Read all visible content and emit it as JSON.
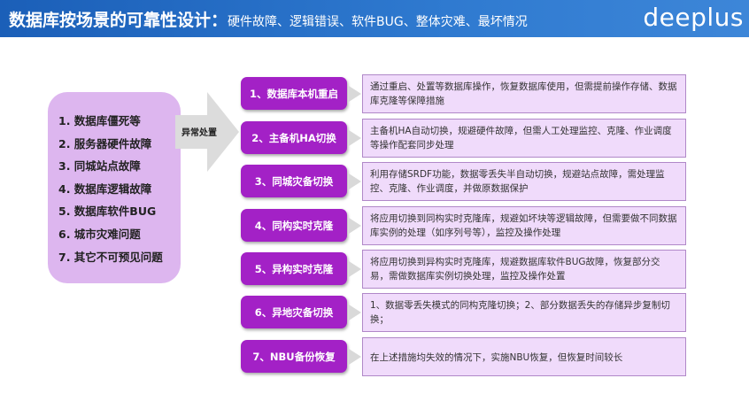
{
  "header": {
    "title_main": "数据库按场景的可靠性设计：",
    "title_sub": "硬件故障、逻辑错误、软件BUG、整体灾难、最坏情况",
    "logo": "deeplus"
  },
  "causes": [
    "1. 数据库僵死等",
    "2. 服务器硬件故障",
    "3. 同城站点故障",
    "4. 数据库逻辑故障",
    "5. 数据库软件BUG",
    "6. 城市灾难问题",
    "7. 其它不可预见问题"
  ],
  "arrow_label": "异常处置",
  "steps": [
    {
      "label": "1、数据库本机重启",
      "desc": "通过重启、处置等数据库操作，恢复数据库使用，但需提前操作存储、数据库克隆等保障措施"
    },
    {
      "label": "2、主备机HA切换",
      "desc": "主备机HA自动切换，规避硬件故障，但需人工处理监控、克隆、作业调度等操作配套同步处理"
    },
    {
      "label": "3、同城灾备切换",
      "desc": "利用存储SRDF功能，数据零丢失半自动切换，规避站点故障，需处理监控、克隆、作业调度，并做原数据保护"
    },
    {
      "label": "4、同构实时克隆",
      "desc": "将应用切换到同构实时克隆库，规避如坏块等逻辑故障，但需要做不同数据库实例的处理（如序列号等），监控及操作处理"
    },
    {
      "label": "5、异构实时克隆",
      "desc": "将应用切换到异构实时克隆库，规避数据库软件BUG故障，恢复部分交易，需做数据库实例切换处理，监控及操作处置"
    },
    {
      "label": "6、异地灾备切换",
      "desc": "1、数据零丢失模式的同构克隆切换；2、部分数据丢失的存储异步复制切换；"
    },
    {
      "label": "7、NBU备份恢复",
      "desc": "在上述措施均失效的情况下，实施NBU恢复，但恢复时间较长"
    }
  ],
  "colors": {
    "header_blue": "#1b5fb8",
    "step_purple": "#a321c6",
    "desc_fill": "#f0dbfb",
    "left_panel_fill": "#ddb6ef",
    "arrow_gray": "#dcdcdc"
  }
}
